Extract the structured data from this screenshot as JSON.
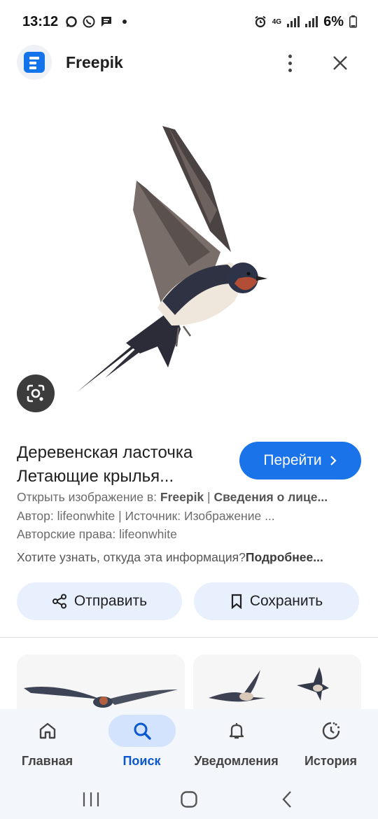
{
  "status_bar": {
    "time": "13:12",
    "network": "4G",
    "battery": "6%"
  },
  "source": {
    "name": "Freepik",
    "brand_color": "#1273eb"
  },
  "result": {
    "title_line1": "Деревенская ласточка",
    "title_line2": "Летающие крылья...",
    "visit_label": "Перейти",
    "open_prefix": "Открыть изображение в:",
    "open_site": "Freepik",
    "open_separator": "|",
    "open_details": "Сведения о лице...",
    "author_line": "Автор: lifeonwhite | Источник: Изображение ...",
    "copyright_line": "Авторские права: lifeonwhite",
    "question_text": "Хотите узнать, откуда эта информация?",
    "question_link": "Подробнее..."
  },
  "actions": {
    "share_label": "Отправить",
    "save_label": "Сохранить"
  },
  "bottom_nav": {
    "items": [
      {
        "label": "Главная",
        "icon": "home-icon"
      },
      {
        "label": "Поиск",
        "icon": "search-icon",
        "active": true
      },
      {
        "label": "Уведомления",
        "icon": "bell-icon"
      },
      {
        "label": "История",
        "icon": "history-icon"
      }
    ]
  },
  "colors": {
    "accent": "#1a73e8",
    "pill_bg": "#e8f0fe",
    "nav_active": "#0b57d0",
    "nav_bg": "#f3f6fb"
  }
}
